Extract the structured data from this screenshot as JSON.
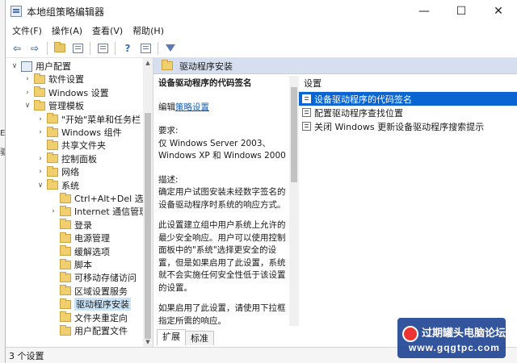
{
  "window": {
    "title": "本地组策略编辑器"
  },
  "window_controls": {
    "minimize": "—",
    "maximize": "☐",
    "close": "✕"
  },
  "menu": [
    "文件(F)",
    "操作(A)",
    "查看(V)",
    "帮助(H)"
  ],
  "tree": {
    "items": [
      {
        "label": "用户配置",
        "chevron": "∨",
        "icon": "user-config-icon"
      },
      {
        "label": "软件设置",
        "chevron": "›"
      },
      {
        "label": "Windows 设置",
        "chevron": "›"
      },
      {
        "label": "管理模板",
        "chevron": "∨"
      },
      {
        "label": "\"开始\"菜单和任务栏",
        "chevron": "›"
      },
      {
        "label": "Windows 组件",
        "chevron": "›"
      },
      {
        "label": "共享文件夹",
        "chevron": ""
      },
      {
        "label": "控制面板",
        "chevron": "›"
      },
      {
        "label": "网络",
        "chevron": "›"
      },
      {
        "label": "系统",
        "chevron": "∨"
      },
      {
        "label": "Ctrl+Alt+Del 选项",
        "chevron": ""
      },
      {
        "label": "Internet 通信管理",
        "chevron": "›"
      },
      {
        "label": "登录",
        "chevron": ""
      },
      {
        "label": "电源管理",
        "chevron": ""
      },
      {
        "label": "缓解选项",
        "chevron": ""
      },
      {
        "label": "脚本",
        "chevron": ""
      },
      {
        "label": "可移动存储访问",
        "chevron": ""
      },
      {
        "label": "区域设置服务",
        "chevron": ""
      },
      {
        "label": "驱动程序安装",
        "chevron": "",
        "selected": true
      },
      {
        "label": "文件夹重定向",
        "chevron": ""
      },
      {
        "label": "用户配置文件",
        "chevron": ""
      }
    ]
  },
  "right": {
    "header": "驱动程序安装",
    "description": {
      "title": "设备驱动程序的代码签名",
      "edit_prefix": "编辑",
      "edit_link": "策略设置",
      "requirements_label": "要求:",
      "requirements": "仅 Windows Server 2003、Windows XP 和 Windows 2000",
      "description_label": "描述:",
      "para1": "确定用户试图安装未经数字签名的设备驱动程序时系统的响应方式。",
      "para2": "此设置建立组中用户系统上允许的最少安全响应。用户可以使用控制面板中的\"系统\"选择更安全的设置，但是如果启用了此设置，系统就不会实施任何安全性低于该设置的设置。",
      "para3": "如果启用了此设置，请使用下拉框指定所需的响应。"
    },
    "settings_header": "设置",
    "settings": [
      {
        "label": "设备驱动程序的代码签名",
        "selected": true
      },
      {
        "label": "配置驱动程序查找位置",
        "selected": false
      },
      {
        "label": "关闭 Windows 更新设备驱动程序搜索提示",
        "selected": false
      }
    ],
    "tabs": [
      {
        "label": "扩展",
        "active": true
      },
      {
        "label": "标准",
        "active": false
      }
    ]
  },
  "status": {
    "text": "3 个设置"
  },
  "watermark": {
    "title": "过期罐头电脑论坛",
    "url": "www.gqgtpc.com"
  },
  "colors": {
    "selection": "#0a64d2",
    "header_band": "#d6dfef",
    "link": "#1a5fb4"
  }
}
